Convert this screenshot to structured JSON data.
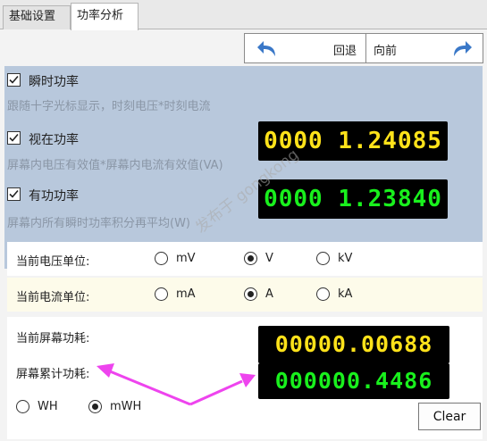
{
  "tabs": [
    {
      "label": "基础设置",
      "active": false
    },
    {
      "label": "功率分析",
      "active": true
    }
  ],
  "toolbar": {
    "back_label": "回退",
    "forward_label": "向前"
  },
  "power": {
    "instant": {
      "label": "瞬时功率",
      "checked": true,
      "desc": "跟随十字光标显示，时刻电压*时刻电流"
    },
    "apparent": {
      "label": "视在功率",
      "checked": true,
      "desc": "屏幕内电压有效值*屏幕内电流有效值(VA)",
      "value": "0000 1.24085"
    },
    "active": {
      "label": "有功功率",
      "checked": true,
      "desc": "屏幕内所有瞬时功率积分再平均(W)",
      "value": "0000 1.23840"
    }
  },
  "voltage_unit": {
    "label": "当前电压单位:",
    "options": [
      "mV",
      "V",
      "kV"
    ],
    "selected": "V"
  },
  "current_unit": {
    "label": "当前电流单位:",
    "options": [
      "mA",
      "A",
      "kA"
    ],
    "selected": "A"
  },
  "consumption": {
    "screen_label": "当前屏幕功耗:",
    "screen_value": "00000.00688",
    "cumulative_label": "屏幕累计功耗:",
    "cumulative_value": "000000.4486",
    "unit_options": [
      "WH",
      "mWH"
    ],
    "unit_selected": "mWH",
    "clear_label": "Clear"
  },
  "watermark": "发布于 gongkong",
  "colors": {
    "lcd_yellow": "#ffe21a",
    "lcd_green": "#19f01d",
    "panel_blue": "#b8c8dc",
    "arrow_magenta": "#ee44ee"
  }
}
